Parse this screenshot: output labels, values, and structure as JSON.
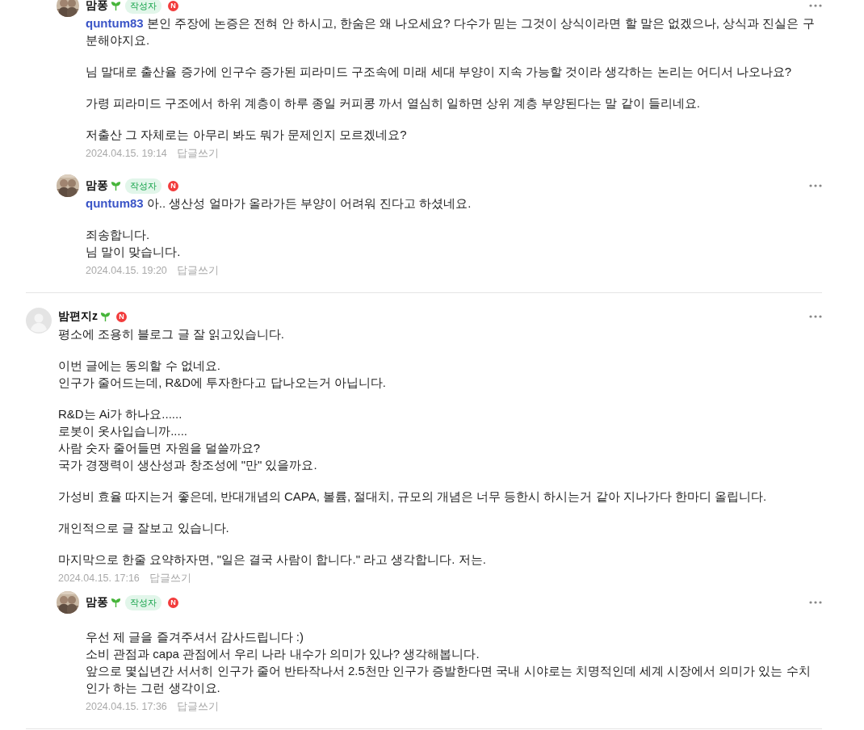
{
  "threads": [
    {
      "replies": [
        {
          "author": "맘퐁",
          "avatar": {
            "kind": "picture"
          },
          "writer_badge": "작성자",
          "new_mark": "N",
          "mention": "quntum83",
          "paragraphs": [
            "본인 주장에 논증은 전혀 안 하시고, 한숨은 왜 나오세요? 다수가 믿는 그것이 상식이라면 할 말은 없겠으나, 상식과 진실은 구분해야지요.",
            "님 말대로 출산율 증가에 인구수 증가된 피라미드 구조속에 미래 세대 부양이 지속 가능할 것이라 생각하는 논리는 어디서 나오나요?",
            "가령 피라미드 구조에서 하위 계층이 하루 종일 커피콩 까서 열심히 일하면 상위 계층 부양된다는 말 같이 들리네요.",
            "저출산 그 자체로는 아무리 봐도 뭐가 문제인지 모르겠네요?"
          ],
          "date": "2024.04.15. 19:14",
          "reply_link": "답글쓰기"
        },
        {
          "author": "맘퐁",
          "avatar": {
            "kind": "picture"
          },
          "writer_badge": "작성자",
          "new_mark": "N",
          "mention": "quntum83",
          "paragraphs": [
            "아.. 생산성 얼마가 올라가든 부양이 어려워 진다고 하셨네요.",
            "죄송합니다.\n님 말이 맞습니다."
          ],
          "date": "2024.04.15. 19:20",
          "reply_link": "답글쓰기"
        }
      ]
    },
    {
      "comment": {
        "author": "밤편지z",
        "avatar": {
          "kind": "placeholder"
        },
        "new_mark": "N",
        "paragraphs": [
          "평소에 조용히 블로그 글 잘 읽고있습니다.",
          "이번 글에는 동의할 수 없네요.\n인구가 줄어드는데, R&D에 투자한다고 답나오는거 아닙니다.",
          "R&D는 Ai가 하나요......\n로봇이 옷사입습니까.....\n사람 숫자 줄어들면 자원을 덜쓸까요?\n국가 경쟁력이 생산성과 창조성에 \"만\" 있을까요.",
          "가성비 효율 따지는거 좋은데, 반대개념의 CAPA, 볼륨, 절대치, 규모의 개념은 너무 등한시 하시는거 같아 지나가다 한마디 올립니다.",
          "개인적으로 글 잘보고 있습니다.",
          "마지막으로 한줄 요약하자면, \"일은 결국 사람이 합니다.\" 라고 생각합니다. 저는."
        ],
        "date": "2024.04.15. 17:16",
        "reply_link": "답글쓰기"
      },
      "replies": [
        {
          "author": "맘퐁",
          "avatar": {
            "kind": "picture"
          },
          "writer_badge": "작성자",
          "new_mark": "N",
          "blank_first_line": true,
          "paragraphs": [
            "우선 제 글을 즐겨주셔서 감사드립니다 :)\n소비 관점과 capa 관점에서 우리 나라 내수가 의미가 있나? 생각해봅니다.\n앞으로 몇십년간 서서히 인구가 줄어 반타작나서 2.5천만 인구가 증발한다면 국내 시야로는 치명적인데 세계 시장에서 의미가 있는 수치인가 하는 그런 생각이요."
          ],
          "date": "2024.04.15. 17:36",
          "reply_link": "답글쓰기"
        }
      ]
    }
  ]
}
